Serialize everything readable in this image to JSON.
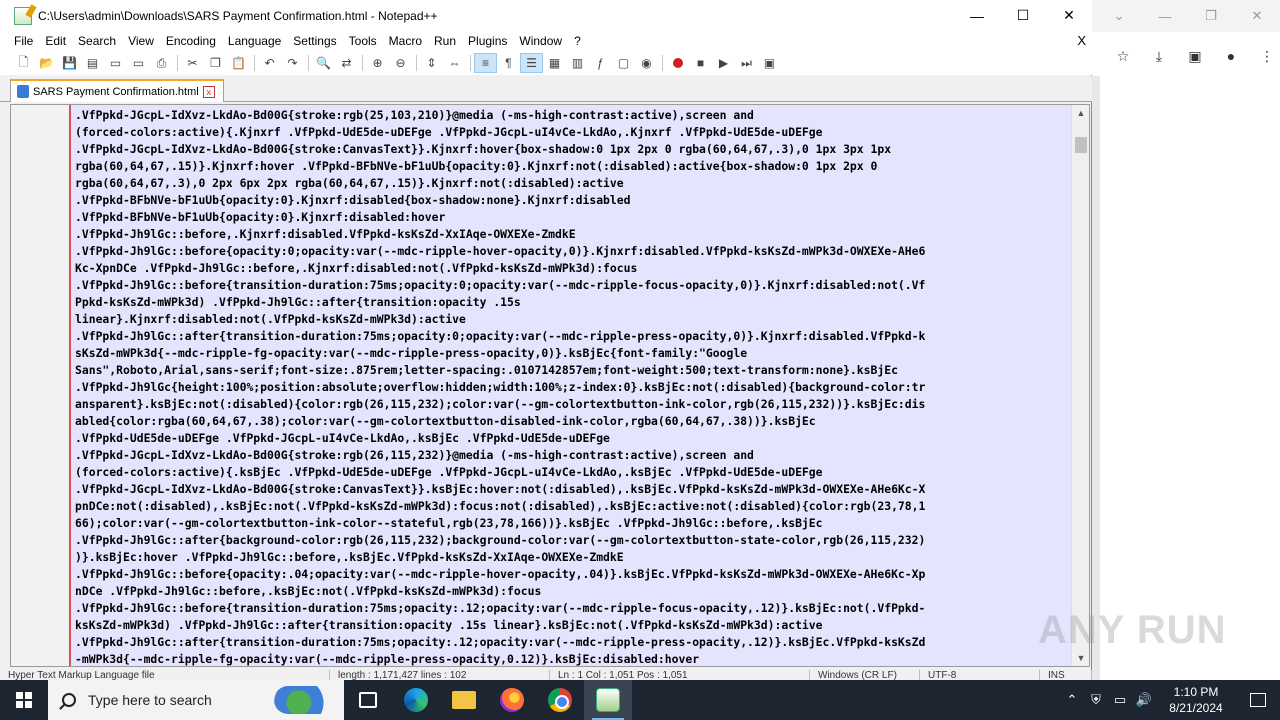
{
  "window": {
    "title": "C:\\Users\\admin\\Downloads\\SARS Payment Confirmation.html - Notepad++",
    "minimize": "—",
    "maximize": "☐",
    "close": "✕"
  },
  "menu": {
    "items": [
      "File",
      "Edit",
      "Search",
      "View",
      "Encoding",
      "Language",
      "Settings",
      "Tools",
      "Macro",
      "Run",
      "Plugins",
      "Window",
      "?"
    ],
    "close": "X"
  },
  "tab": {
    "label": "SARS Payment Confirmation.html",
    "close": "x"
  },
  "editor": {
    "lines": [
      ".VfPpkd-JGcpL-IdXvz-LkdAo-Bd00G{stroke:rgb(25,103,210)}@media (-ms-high-contrast:active),screen and",
      "(forced-colors:active){.Kjnxrf .VfPpkd-UdE5de-uDEFge .VfPpkd-JGcpL-uI4vCe-LkdAo,.Kjnxrf .VfPpkd-UdE5de-uDEFge",
      ".VfPpkd-JGcpL-IdXvz-LkdAo-Bd00G{stroke:CanvasText}}.Kjnxrf:hover{box-shadow:0 1px 2px 0 rgba(60,64,67,.3),0 1px 3px 1px",
      "rgba(60,64,67,.15)}.Kjnxrf:hover .VfPpkd-BFbNVe-bF1uUb{opacity:0}.Kjnxrf:not(:disabled):active{box-shadow:0 1px 2px 0",
      "rgba(60,64,67,.3),0 2px 6px 2px rgba(60,64,67,.15)}.Kjnxrf:not(:disabled):active",
      ".VfPpkd-BFbNVe-bF1uUb{opacity:0}.Kjnxrf:disabled{box-shadow:none}.Kjnxrf:disabled",
      ".VfPpkd-BFbNVe-bF1uUb{opacity:0}.Kjnxrf:disabled:hover",
      ".VfPpkd-Jh9lGc::before,.Kjnxrf:disabled.VfPpkd-ksKsZd-XxIAqe-OWXEXe-ZmdkE",
      ".VfPpkd-Jh9lGc::before{opacity:0;opacity:var(--mdc-ripple-hover-opacity,0)}.Kjnxrf:disabled.VfPpkd-ksKsZd-mWPk3d-OWXEXe-AHe6",
      "Kc-XpnDCe .VfPpkd-Jh9lGc::before,.Kjnxrf:disabled:not(.VfPpkd-ksKsZd-mWPk3d):focus",
      ".VfPpkd-Jh9lGc::before{transition-duration:75ms;opacity:0;opacity:var(--mdc-ripple-focus-opacity,0)}.Kjnxrf:disabled:not(.Vf",
      "Ppkd-ksKsZd-mWPk3d) .VfPpkd-Jh9lGc::after{transition:opacity .15s",
      "linear}.Kjnxrf:disabled:not(.VfPpkd-ksKsZd-mWPk3d):active",
      ".VfPpkd-Jh9lGc::after{transition-duration:75ms;opacity:0;opacity:var(--mdc-ripple-press-opacity,0)}.Kjnxrf:disabled.VfPpkd-k",
      "sKsZd-mWPk3d{--mdc-ripple-fg-opacity:var(--mdc-ripple-press-opacity,0)}.ksBjEc{font-family:\"Google",
      "Sans\",Roboto,Arial,sans-serif;font-size:.875rem;letter-spacing:.0107142857em;font-weight:500;text-transform:none}.ksBjEc",
      ".VfPpkd-Jh9lGc{height:100%;position:absolute;overflow:hidden;width:100%;z-index:0}.ksBjEc:not(:disabled){background-color:tr",
      "ansparent}.ksBjEc:not(:disabled){color:rgb(26,115,232);color:var(--gm-colortextbutton-ink-color,rgb(26,115,232))}.ksBjEc:dis",
      "abled{color:rgba(60,64,67,.38);color:var(--gm-colortextbutton-disabled-ink-color,rgba(60,64,67,.38))}.ksBjEc",
      ".VfPpkd-UdE5de-uDEFge .VfPpkd-JGcpL-uI4vCe-LkdAo,.ksBjEc .VfPpkd-UdE5de-uDEFge",
      ".VfPpkd-JGcpL-IdXvz-LkdAo-Bd00G{stroke:rgb(26,115,232)}@media (-ms-high-contrast:active),screen and",
      "(forced-colors:active){.ksBjEc .VfPpkd-UdE5de-uDEFge .VfPpkd-JGcpL-uI4vCe-LkdAo,.ksBjEc .VfPpkd-UdE5de-uDEFge",
      ".VfPpkd-JGcpL-IdXvz-LkdAo-Bd00G{stroke:CanvasText}}.ksBjEc:hover:not(:disabled),.ksBjEc.VfPpkd-ksKsZd-mWPk3d-OWXEXe-AHe6Kc-X",
      "pnDCe:not(:disabled),.ksBjEc:not(.VfPpkd-ksKsZd-mWPk3d):focus:not(:disabled),.ksBjEc:active:not(:disabled){color:rgb(23,78,1",
      "66);color:var(--gm-colortextbutton-ink-color--stateful,rgb(23,78,166))}.ksBjEc .VfPpkd-Jh9lGc::before,.ksBjEc",
      ".VfPpkd-Jh9lGc::after{background-color:rgb(26,115,232);background-color:var(--gm-colortextbutton-state-color,rgb(26,115,232)",
      ")}.ksBjEc:hover .VfPpkd-Jh9lGc::before,.ksBjEc.VfPpkd-ksKsZd-XxIAqe-OWXEXe-ZmdkE",
      ".VfPpkd-Jh9lGc::before{opacity:.04;opacity:var(--mdc-ripple-hover-opacity,.04)}.ksBjEc.VfPpkd-ksKsZd-mWPk3d-OWXEXe-AHe6Kc-Xp",
      "nDCe .VfPpkd-Jh9lGc::before,.ksBjEc:not(.VfPpkd-ksKsZd-mWPk3d):focus",
      ".VfPpkd-Jh9lGc::before{transition-duration:75ms;opacity:.12;opacity:var(--mdc-ripple-focus-opacity,.12)}.ksBjEc:not(.VfPpkd-",
      "ksKsZd-mWPk3d) .VfPpkd-Jh9lGc::after{transition:opacity .15s linear}.ksBjEc:not(.VfPpkd-ksKsZd-mWPk3d):active",
      ".VfPpkd-Jh9lGc::after{transition-duration:75ms;opacity:.12;opacity:var(--mdc-ripple-press-opacity,.12)}.ksBjEc.VfPpkd-ksKsZd",
      "-mWPk3d{--mdc-ripple-fg-opacity:var(--mdc-ripple-press-opacity,0.12)}.ksBjEc:disabled:hover"
    ]
  },
  "statusbar": {
    "type": "Hyper Text Markup Language file",
    "length": "length : 1,171,427   lines : 102",
    "position": "Ln : 1    Col : 1,051    Pos : 1,051",
    "eol": "Windows (CR LF)",
    "encoding": "UTF-8",
    "mode": "INS"
  },
  "watermark": "ANY RUN",
  "taskbar": {
    "search_placeholder": "Type here to search",
    "time": "1:10 PM",
    "date": "8/21/2024"
  },
  "colors": {
    "editor_selection": "#e4e4ff",
    "taskbar": "#1d2530",
    "tab_accent": "#f5a623"
  }
}
